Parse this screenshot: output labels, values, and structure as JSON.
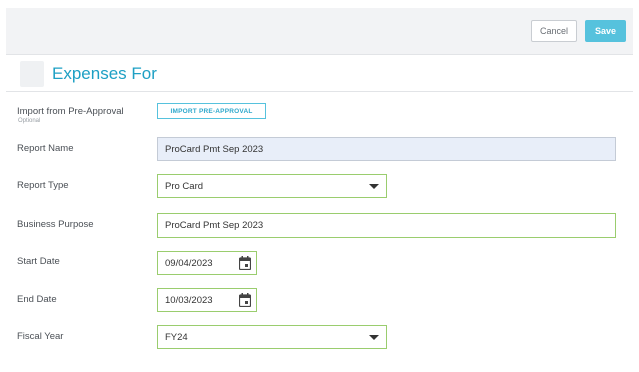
{
  "toolbar": {
    "cancel_label": "Cancel",
    "save_label": "Save"
  },
  "header": {
    "title": "Expenses For"
  },
  "form": {
    "import": {
      "label": "Import from Pre-Approval",
      "sublabel": "Optional",
      "button_label": "IMPORT PRE-APPROVAL"
    },
    "report_name": {
      "label": "Report Name",
      "value": "ProCard Pmt Sep 2023"
    },
    "report_type": {
      "label": "Report Type",
      "value": "Pro Card"
    },
    "business_purpose": {
      "label": "Business Purpose",
      "value": "ProCard Pmt Sep 2023"
    },
    "start_date": {
      "label": "Start Date",
      "value": "09/04/2023"
    },
    "end_date": {
      "label": "End Date",
      "value": "10/03/2023"
    },
    "fiscal_year": {
      "label": "Fiscal Year",
      "value": "FY24"
    }
  },
  "icons": {
    "dropdown": "chevron-down-icon",
    "calendar": "calendar-icon",
    "logo": "logo-placeholder"
  },
  "colors": {
    "accent": "#1ea0c4",
    "save_button": "#56c2dd",
    "valid_border": "#9acd6e",
    "readonly_bg": "#e8eef9"
  }
}
